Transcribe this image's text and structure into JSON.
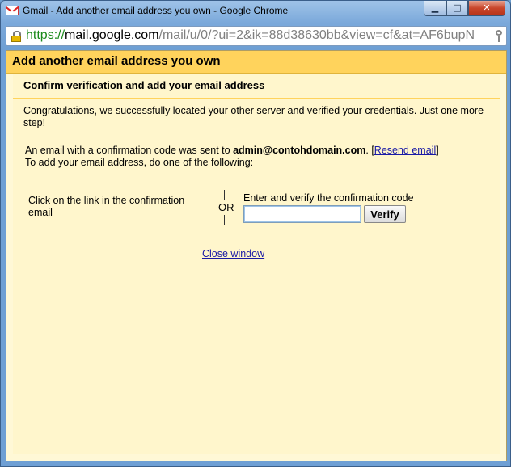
{
  "window": {
    "title": "Gmail - Add another email address you own - Google Chrome",
    "min_glyph": "▁",
    "max_glyph": "□",
    "close_glyph": "✕"
  },
  "addressbar": {
    "scheme": "https://",
    "host": "mail.google.com",
    "path": "/mail/u/0/?ui=2&ik=88d38630bb&view=cf&at=AF6bupN"
  },
  "dialog": {
    "title": "Add another email address you own",
    "subtitle": "Confirm verification and add your email address",
    "congrats": "Congratulations, we successfully located your other server and verified your credentials. Just one more step!",
    "sent_prefix": "An email with a confirmation code was sent to ",
    "email": "admin@contohdomain.com",
    "sent_suffix": ". ",
    "resend_open": "[",
    "resend_label": "Resend email",
    "resend_close": "]",
    "todo": "To add your email address, do one of the following:",
    "option1": "Click on the link in the confirmation email",
    "or_label": "OR",
    "option2": "Enter and verify the confirmation code",
    "code_value": "",
    "verify_label": "Verify",
    "close_label": "Close window"
  },
  "colors": {
    "header_bg": "#ffd35c",
    "content_bg": "#fff6cc",
    "link": "#1a1aa6"
  }
}
